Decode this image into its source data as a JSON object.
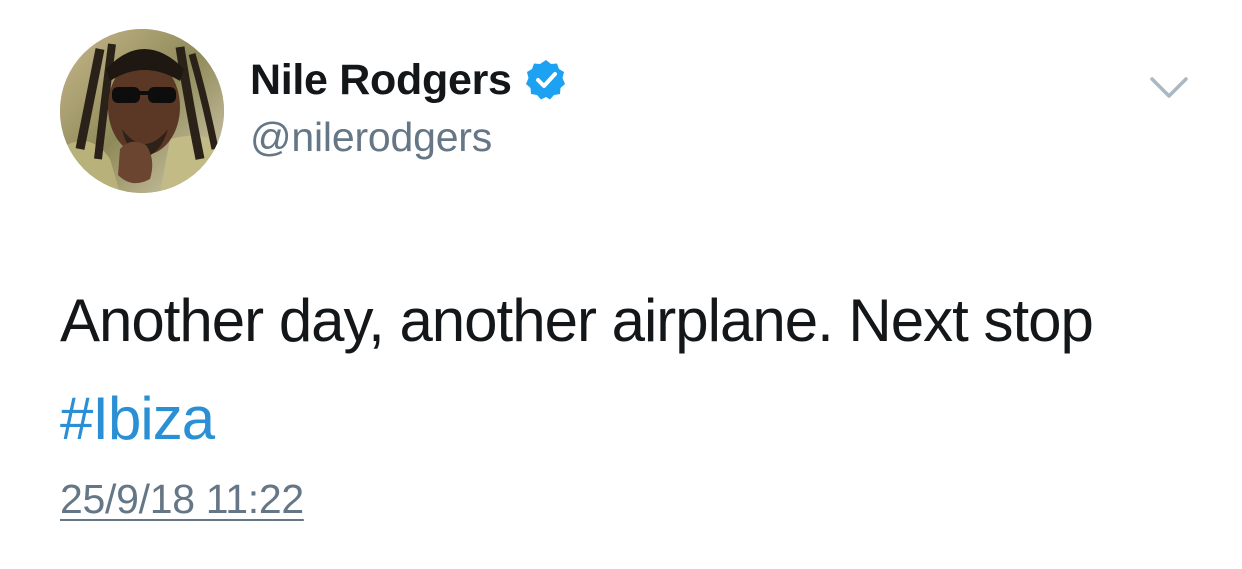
{
  "tweet": {
    "author": {
      "display_name": "Nile Rodgers",
      "handle": "@nilerodgers",
      "verified": true,
      "avatar_icon": "profile-photo-avatar",
      "verified_icon": "verified-badge-icon"
    },
    "menu_icon": "chevron-down-icon",
    "text": {
      "line1": "Another day, another airplane. Next stop",
      "hashtag": "#Ibiza"
    },
    "timestamp": "25/9/18 11:22"
  },
  "colors": {
    "name": "#14171a",
    "secondary": "#657786",
    "link": "#2b8fd6",
    "verified_badge": "#1da1f2",
    "chevron": "#aab8c2"
  }
}
